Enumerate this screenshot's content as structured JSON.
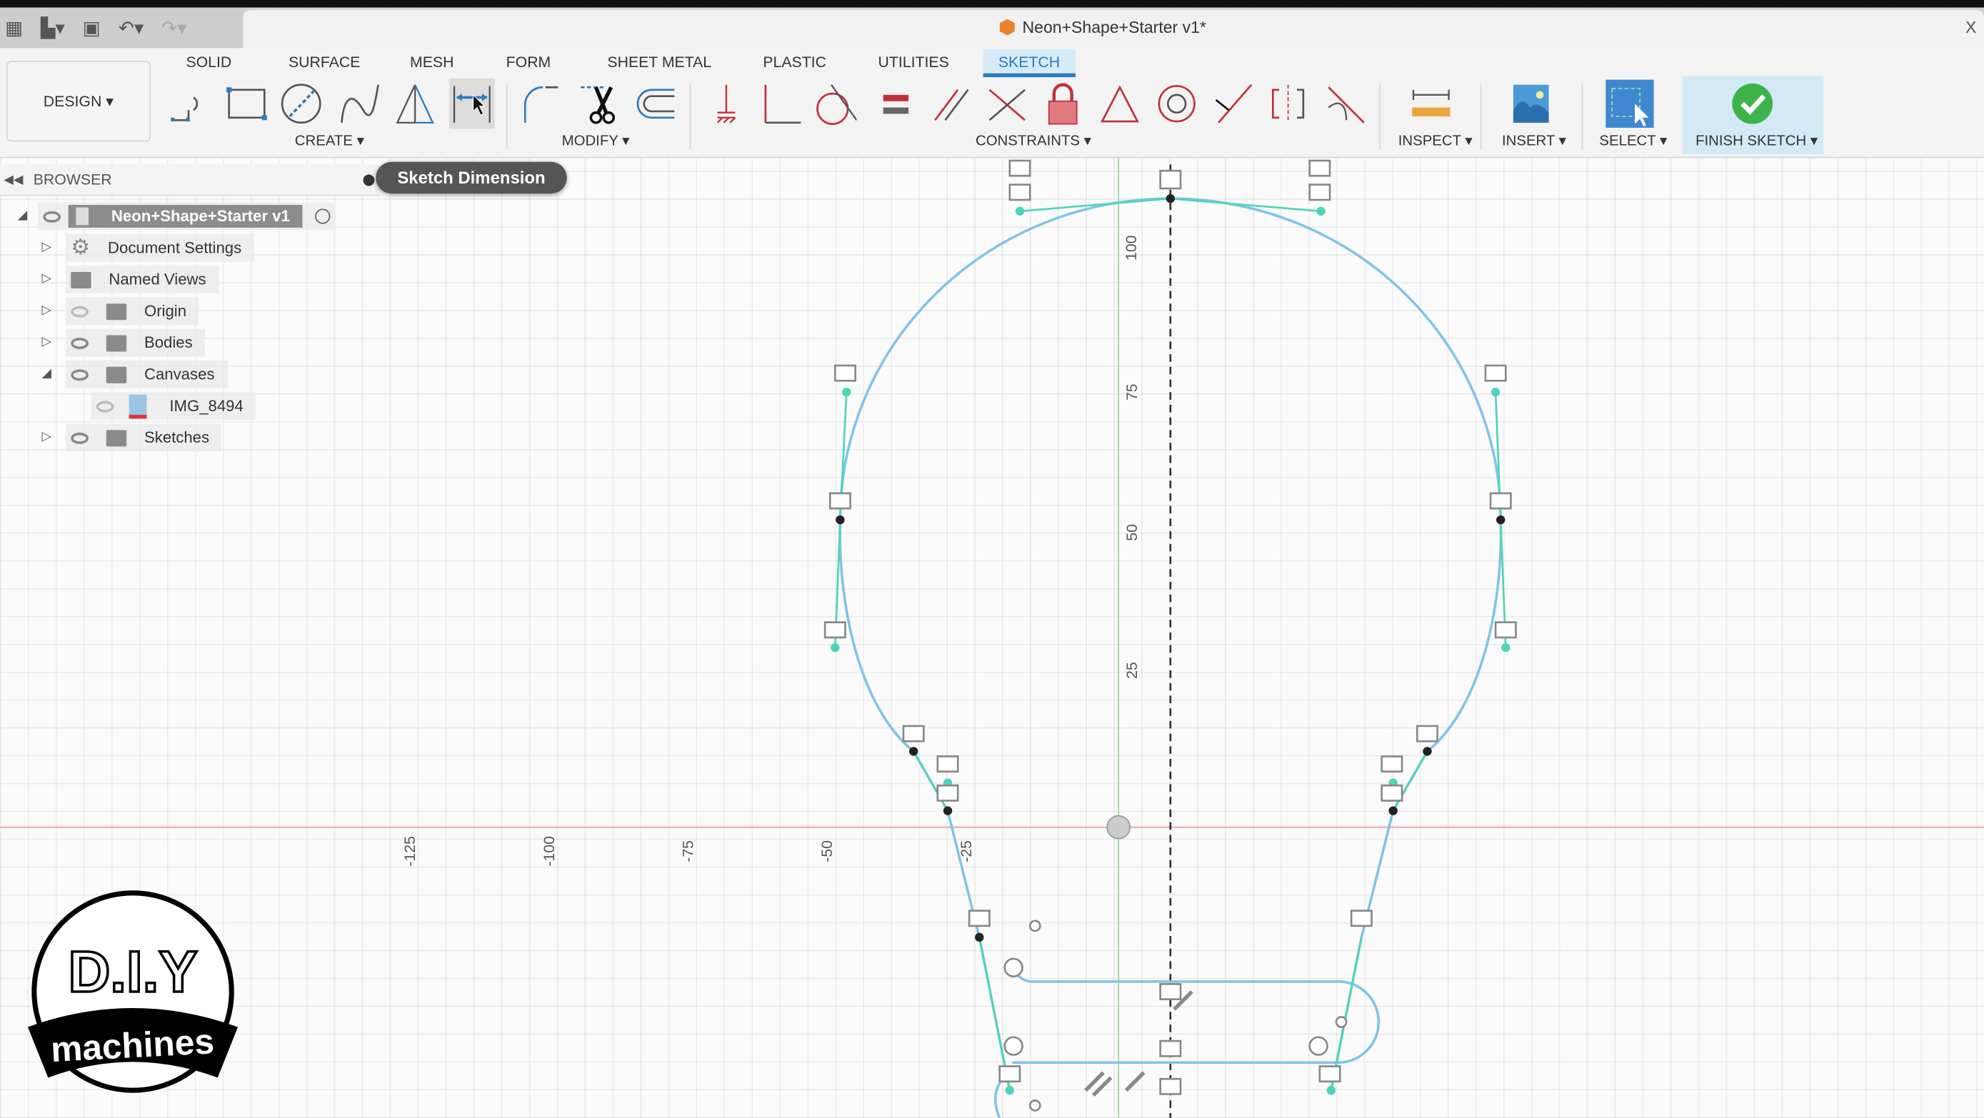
{
  "window": {
    "title": "Neon+Shape+Starter v1*",
    "close": "X"
  },
  "quick_access": {
    "icons": [
      "grid-icon",
      "file-icon",
      "save-icon",
      "undo-icon",
      "redo-icon"
    ]
  },
  "workspace": {
    "label": "DESIGN ▾"
  },
  "tabs": [
    "SOLID",
    "SURFACE",
    "MESH",
    "FORM",
    "SHEET METAL",
    "PLASTIC",
    "UTILITIES",
    "SKETCH"
  ],
  "active_tab": "SKETCH",
  "groups": {
    "create": "CREATE ▾",
    "modify": "MODIFY ▾",
    "constraints": "CONSTRAINTS ▾",
    "inspect": "INSPECT ▾",
    "insert": "INSERT ▾",
    "select": "SELECT ▾",
    "finish": "FINISH SKETCH ▾"
  },
  "tooltip": "Sketch Dimension",
  "browser": {
    "title": "BROWSER",
    "root": "Neon+Shape+Starter v1",
    "items": [
      {
        "label": "Document Settings",
        "icon": "gear-icon"
      },
      {
        "label": "Named Views",
        "icon": "folder-icon"
      },
      {
        "label": "Origin",
        "icon": "folder-icon",
        "visible": false
      },
      {
        "label": "Bodies",
        "icon": "folder-icon",
        "visible": true
      },
      {
        "label": "Canvases",
        "icon": "folder-icon",
        "visible": true,
        "expanded": true
      },
      {
        "label": "IMG_8494",
        "icon": "image-icon",
        "visible": false
      },
      {
        "label": "Sketches",
        "icon": "folder-icon",
        "visible": true
      }
    ]
  },
  "axis_labels": {
    "vertical": [
      "100",
      "75",
      "50",
      "25"
    ],
    "horizontal": [
      "-125",
      "-100",
      "-75",
      "-50",
      "-25"
    ]
  },
  "logo": {
    "line1": "D.I.Y",
    "line2": "machines"
  },
  "colors": {
    "accent": "#2a7bc0",
    "sketch_line": "#7fc4e6",
    "constraint_line": "#4fd4b8",
    "x_axis": "#e9a0a0",
    "y_axis": "#9fd89f",
    "finish_green": "#3db34a"
  }
}
